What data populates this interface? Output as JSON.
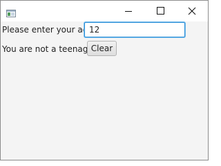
{
  "window": {
    "title": "",
    "app_icon": "window-app-icon",
    "controls": [
      "minimize-icon",
      "maximize-icon",
      "close-icon"
    ]
  },
  "form": {
    "age_label": "Please enter your age:",
    "age_value": "12",
    "status_message": "You are not a teenager.",
    "clear_label": "Clear"
  },
  "colors": {
    "focus_border": "#2a8ed6",
    "content_background": "#f4f4f4",
    "titlebar_background": "#ffffff"
  }
}
